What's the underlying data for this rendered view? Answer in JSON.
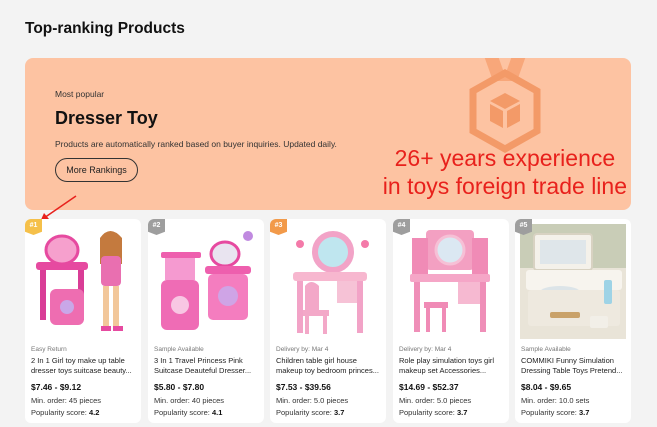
{
  "page_title": "Top-ranking Products",
  "banner": {
    "kicker": "Most popular",
    "title": "Dresser Toy",
    "description": "Products are automatically ranked based on buyer inquiries. Updated daily.",
    "button_label": "More Rankings",
    "overlay_line1": "26+ years experience",
    "overlay_line2": "in toys foreign trade line",
    "overlay_color": "#e8211c",
    "background_color": "#fdc3a2"
  },
  "products": [
    {
      "rank": "#1",
      "rank_color": "#f5c04a",
      "tag": "Easy Return",
      "title": "2 In 1 Girl toy make up table dresser toys suitcase beauty...",
      "price": "$7.46 - $9.12",
      "moq_label": "Min. order: 45 pieces",
      "score_label": "Popularity score:",
      "score": "4.2"
    },
    {
      "rank": "#2",
      "rank_color": "#9e9e9e",
      "tag": "Sample Available",
      "title": "3 In 1 Travel Princess Pink Suitcase Deauteful Dresser...",
      "price": "$5.80 - $7.80",
      "moq_label": "Min. order: 40 pieces",
      "score_label": "Popularity score:",
      "score": "4.1"
    },
    {
      "rank": "#3",
      "rank_color": "#f29a4a",
      "tag": "Delivery by: Mar 4",
      "title": "Children table girl house makeup toy bedroom princes...",
      "price": "$7.53 - $39.56",
      "moq_label": "Min. order: 5.0 pieces",
      "score_label": "Popularity score:",
      "score": "3.7"
    },
    {
      "rank": "#4",
      "rank_color": "#9e9e9e",
      "tag": "Delivery by: Mar 4",
      "title": "Role play simulation toys girl makeup set Accessories...",
      "price": "$14.69 - $52.37",
      "moq_label": "Min. order: 5.0 pieces",
      "score_label": "Popularity score:",
      "score": "3.7"
    },
    {
      "rank": "#5",
      "rank_color": "#9e9e9e",
      "tag": "Sample Available",
      "title": "COMMIKI Funny Simulation Dressing Table Toys Pretend...",
      "price": "$8.04 - $9.65",
      "moq_label": "Min. order: 10.0 sets",
      "score_label": "Popularity score:",
      "score": "3.7"
    }
  ]
}
